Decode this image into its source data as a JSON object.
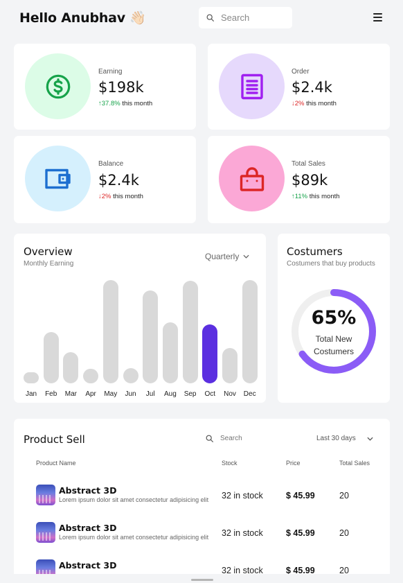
{
  "header": {
    "greeting": "Hello Anubhav",
    "wave_emoji": "👋🏻",
    "search_placeholder": "Search"
  },
  "stats": [
    {
      "label": "Earning",
      "value": "$198k",
      "change": "37.8%",
      "direction": "up",
      "suffix": "this month",
      "icon": "dollar-icon",
      "icon_color": "#16a34a",
      "circle_color": "#dcfce7"
    },
    {
      "label": "Order",
      "value": "$2.4k",
      "change": "2%",
      "direction": "down",
      "suffix": "this month",
      "icon": "document-icon",
      "icon_color": "#a020f0",
      "circle_color": "#e6d9fc"
    },
    {
      "label": "Balance",
      "value": "$2.4k",
      "change": "2%",
      "direction": "down",
      "suffix": "this month",
      "icon": "wallet-icon",
      "icon_color": "#1d6fd0",
      "circle_color": "#d5f0fd"
    },
    {
      "label": "Total Sales",
      "value": "$89k",
      "change": "11%",
      "direction": "up",
      "suffix": "this month",
      "icon": "shopping-bag-icon",
      "icon_color": "#dc2626",
      "circle_color": "#fba8d6"
    }
  ],
  "overview": {
    "title": "Overview",
    "subtitle": "Monthly Earning",
    "period": "Quarterly"
  },
  "chart_data": {
    "type": "bar",
    "categories": [
      "Jan",
      "Feb",
      "Mar",
      "Apr",
      "May",
      "Jun",
      "Jul",
      "Aug",
      "Sep",
      "Oct",
      "Nov",
      "Dec"
    ],
    "values": [
      10,
      50,
      30,
      14,
      100,
      15,
      90,
      59,
      99,
      57,
      34,
      100
    ],
    "highlight": "Oct",
    "highlight_color": "#5b2fe0",
    "bar_color": "#d9d9d9",
    "title": "",
    "xlabel": "",
    "ylabel": ""
  },
  "customers": {
    "title": "Costumers",
    "subtitle": "Costumers that buy products",
    "percent": 65,
    "percent_label": "65%",
    "caption_line1": "Total New",
    "caption_line2": "Costumers",
    "ring_color": "#8b5cf6",
    "track_color": "#efefef"
  },
  "product_sell": {
    "title": "Product Sell",
    "search_placeholder": "Search",
    "period": "Last 30 days",
    "columns": [
      "Product Name",
      "Stock",
      "Price",
      "Total Sales"
    ],
    "rows": [
      {
        "name": "Abstract 3D",
        "desc": "Lorem ipsum dolor sit amet consectetur adipisicing elit",
        "stock": "32 in stock",
        "price": "$ 45.99",
        "sales": "20"
      },
      {
        "name": "Abstract 3D",
        "desc": "Lorem ipsum dolor sit amet consectetur adipisicing elit",
        "stock": "32 in stock",
        "price": "$ 45.99",
        "sales": "20"
      },
      {
        "name": "Abstract 3D",
        "desc": "",
        "stock": "32 in stock",
        "price": "$ 45.99",
        "sales": "20"
      }
    ]
  }
}
